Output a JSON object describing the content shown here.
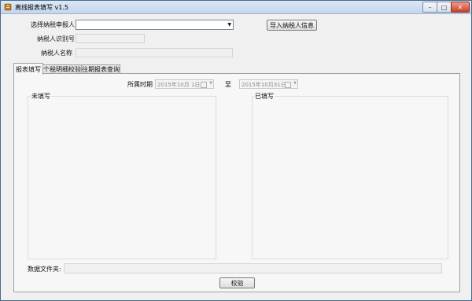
{
  "window": {
    "title": "离线报表填写 v1.5",
    "min": "–",
    "max": "□",
    "close": "✕"
  },
  "taxpayer": {
    "select_label": "选择纳税申报人",
    "select_value": "",
    "import_button": "导入纳税人信息",
    "id_label": "纳税人识别号",
    "id_value": "",
    "name_label": "纳税人名称",
    "name_value": ""
  },
  "tabs": [
    {
      "label": "报表填写",
      "active": true
    },
    {
      "label": "个税明细校验",
      "active": false
    },
    {
      "label": "往期报表查询",
      "active": false
    }
  ],
  "period": {
    "label": "所属时期",
    "from": "2015年10月 1日",
    "to_label": "至",
    "to": "2015年10月31日"
  },
  "lists": {
    "unfilled_label": "未填写",
    "filled_label": "已填写"
  },
  "footer": {
    "data_folder_label": "数据文件夹:",
    "data_folder_value": "",
    "verify_button": "校验"
  },
  "colors": {
    "titlebar": "#c4d6ec",
    "close": "#c8402a",
    "panel": "#f7f7f7"
  }
}
